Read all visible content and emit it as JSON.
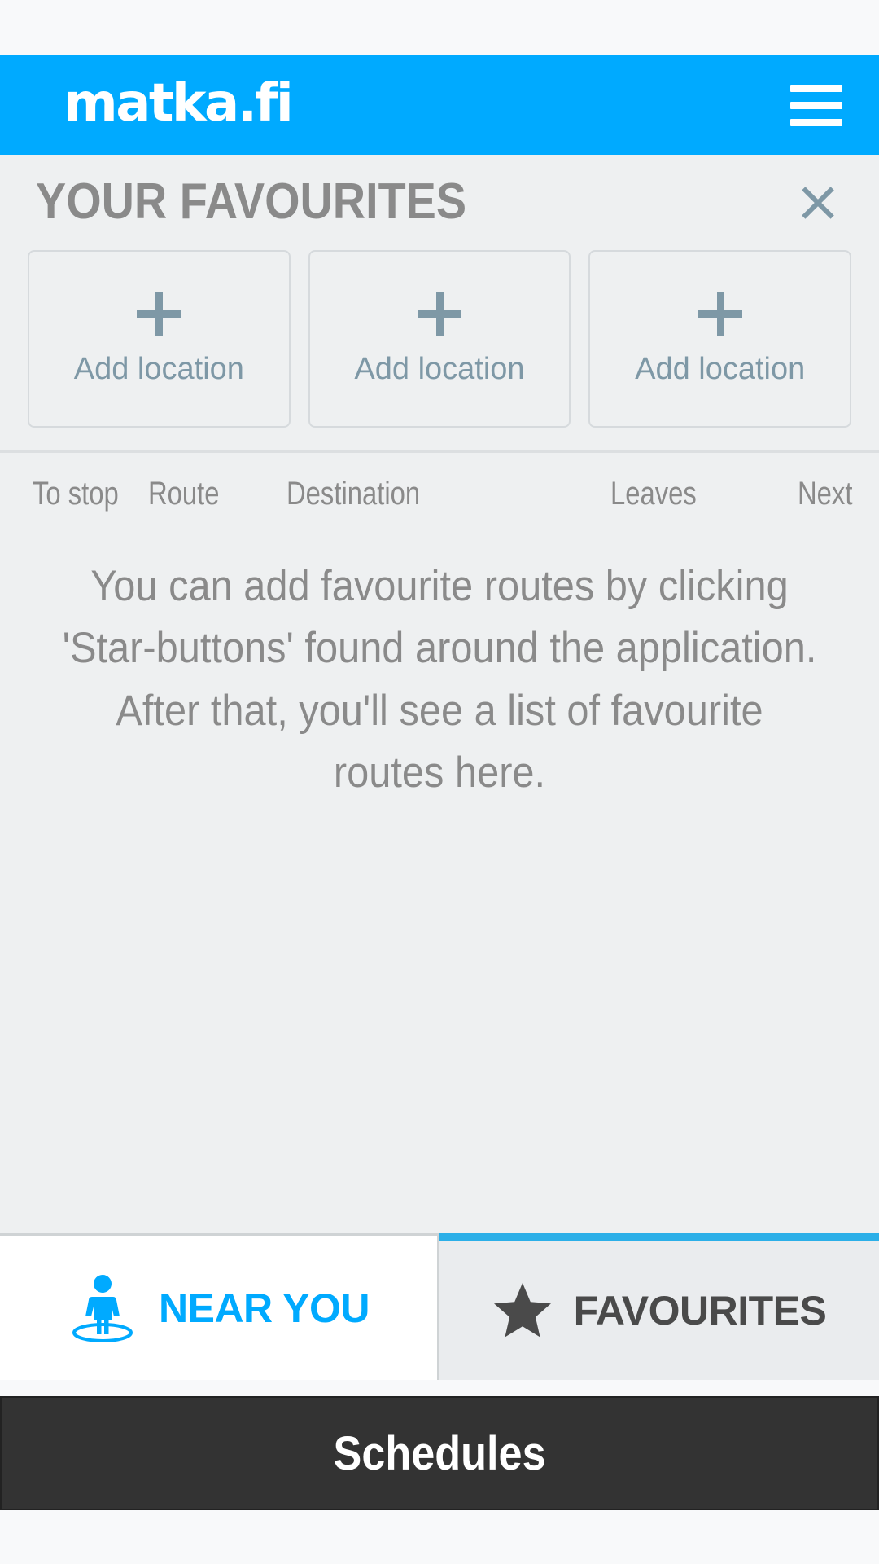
{
  "colors": {
    "brand_cyan": "#00AAFF",
    "tab_active_bar": "#2BAFE8",
    "slate": "#7e98a6",
    "text_gray": "#8a8a8a",
    "dark_button": "#333333",
    "panel_bg": "#eef0f1"
  },
  "header": {
    "logo_text": "matka.fi",
    "menu_icon": "hamburger-menu-icon"
  },
  "panel": {
    "title": "YOUR FAVOURITES",
    "close_icon": "close-x-icon",
    "favourite_slots": [
      {
        "icon": "plus-icon",
        "label": "Add location"
      },
      {
        "icon": "plus-icon",
        "label": "Add location"
      },
      {
        "icon": "plus-icon",
        "label": "Add location"
      }
    ],
    "columns": {
      "to_stop": "To stop",
      "route": "Route",
      "destination": "Destination",
      "leaves": "Leaves",
      "next": "Next"
    },
    "empty_message": "You can add favourite routes by clicking 'Star-buttons' found around the application. After that, you'll see a list of favourite routes here."
  },
  "tabbar": {
    "tabs": [
      {
        "label": "NEAR YOU",
        "icon": "person-location-icon",
        "active": false
      },
      {
        "label": "FAVOURITES",
        "icon": "star-icon",
        "active": true
      }
    ]
  },
  "footer": {
    "schedules_label": "Schedules"
  }
}
